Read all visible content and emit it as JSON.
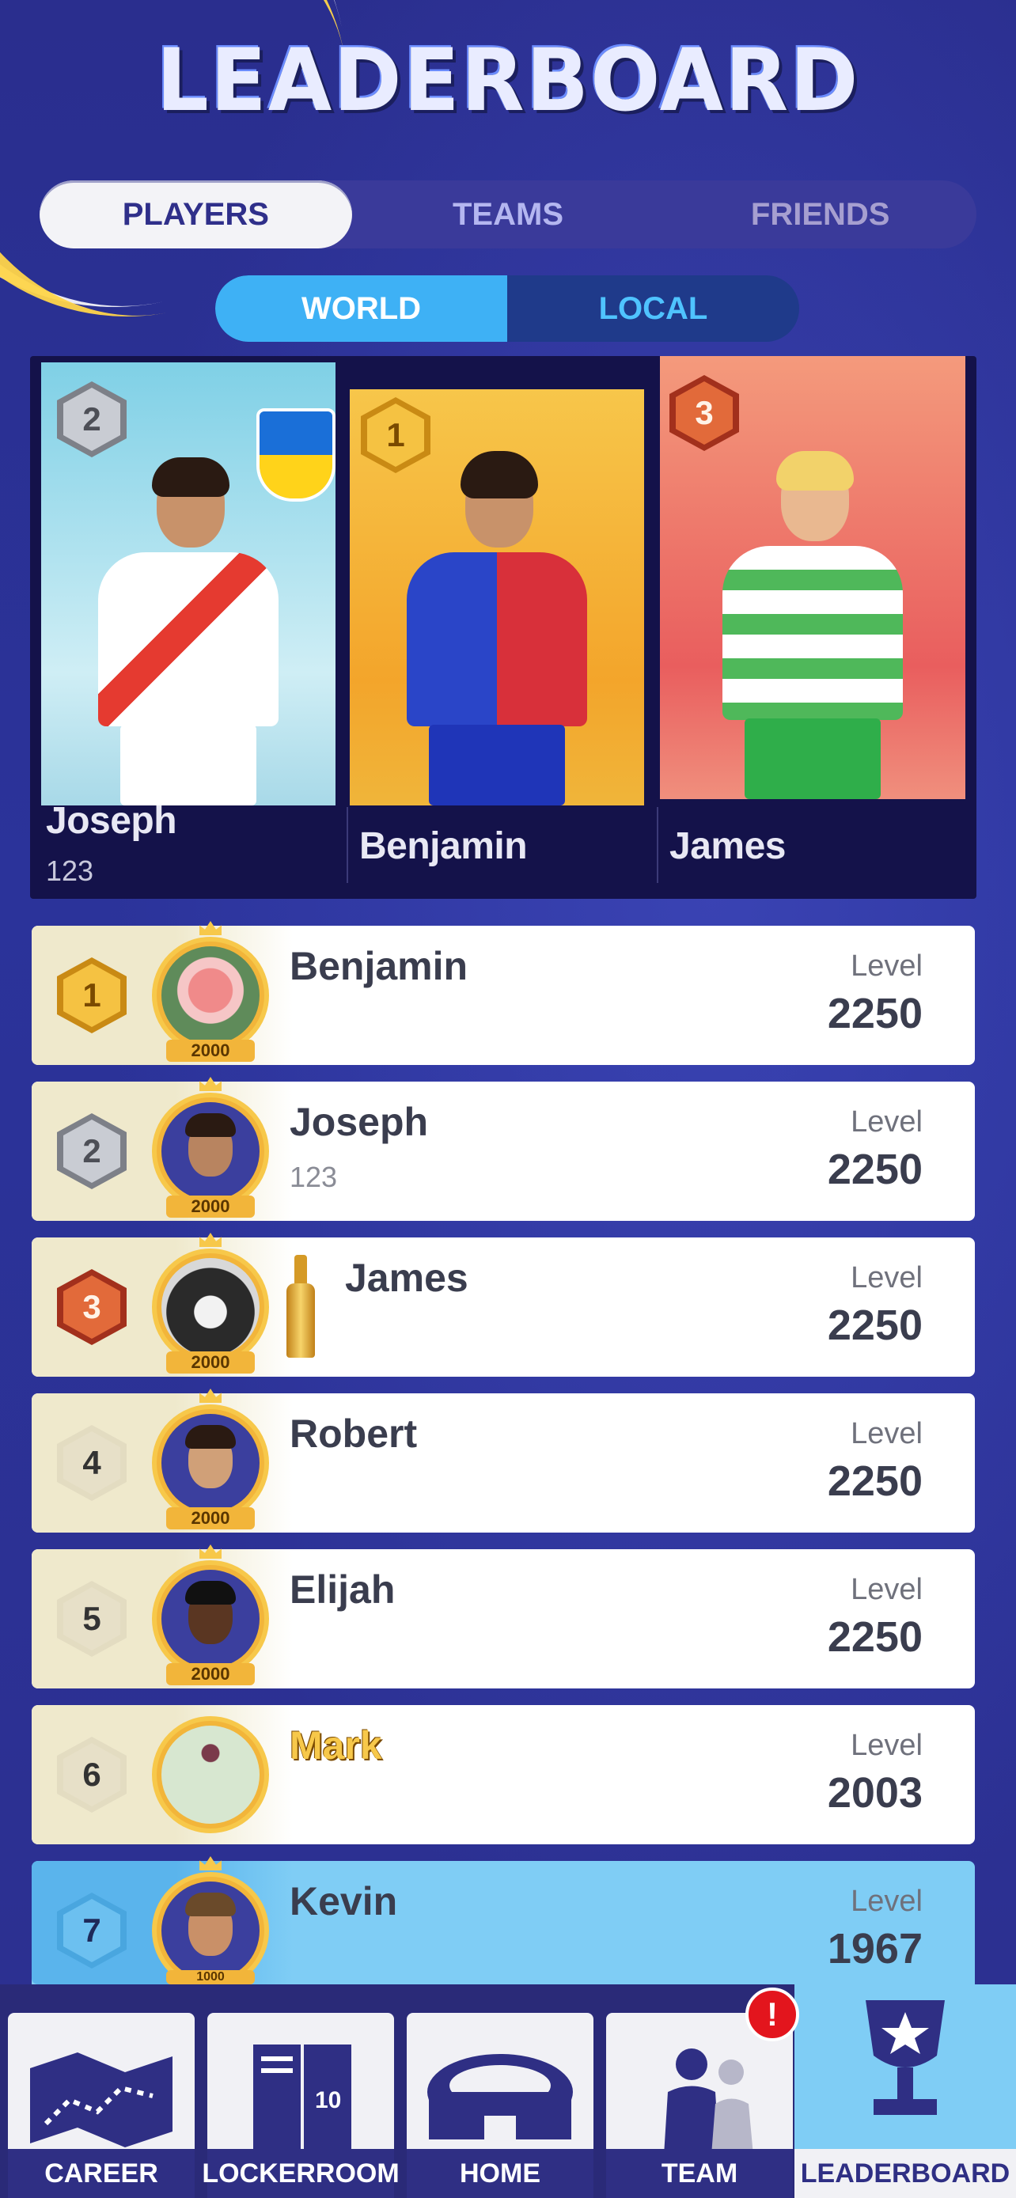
{
  "title": "LEADERBOARD",
  "tabs": [
    "PLAYERS",
    "TEAMS",
    "FRIENDS"
  ],
  "active_tab": "PLAYERS",
  "scope": [
    "WORLD",
    "LOCAL"
  ],
  "active_scope": "WORLD",
  "podium": [
    {
      "rank": "2",
      "name": "Joseph",
      "sub": "123"
    },
    {
      "rank": "1",
      "name": "Benjamin",
      "sub": ""
    },
    {
      "rank": "3",
      "name": "James",
      "sub": ""
    }
  ],
  "level_label": "Level",
  "rows": [
    {
      "rank": "1",
      "name": "Benjamin",
      "sub": "",
      "badge_level": "2000",
      "level": "2250"
    },
    {
      "rank": "2",
      "name": "Joseph",
      "sub": "123",
      "badge_level": "2000",
      "level": "2250"
    },
    {
      "rank": "3",
      "name": "James",
      "sub": "",
      "badge_level": "2000",
      "level": "2250"
    },
    {
      "rank": "4",
      "name": "Robert",
      "sub": "",
      "badge_level": "2000",
      "level": "2250"
    },
    {
      "rank": "5",
      "name": "Elijah",
      "sub": "",
      "badge_level": "2000",
      "level": "2250"
    },
    {
      "rank": "6",
      "name": "Mark",
      "sub": "",
      "badge_level": "",
      "level": "2003"
    },
    {
      "rank": "7",
      "name": "Kevin",
      "sub": "",
      "badge_level": "1000",
      "level": "1967"
    }
  ],
  "nav": [
    {
      "label": "CAREER",
      "icon": "map-icon"
    },
    {
      "label": "LOCKERROOM",
      "icon": "locker-icon"
    },
    {
      "label": "HOME",
      "icon": "stadium-icon"
    },
    {
      "label": "TEAM",
      "icon": "players-icon",
      "alert": "!"
    },
    {
      "label": "LEADERBOARD",
      "icon": "trophy-icon"
    }
  ],
  "colors": {
    "accent": "#3eb1f5",
    "navbar": "#2f2f84",
    "gold": "#f7c84a",
    "background": "#262b87"
  }
}
